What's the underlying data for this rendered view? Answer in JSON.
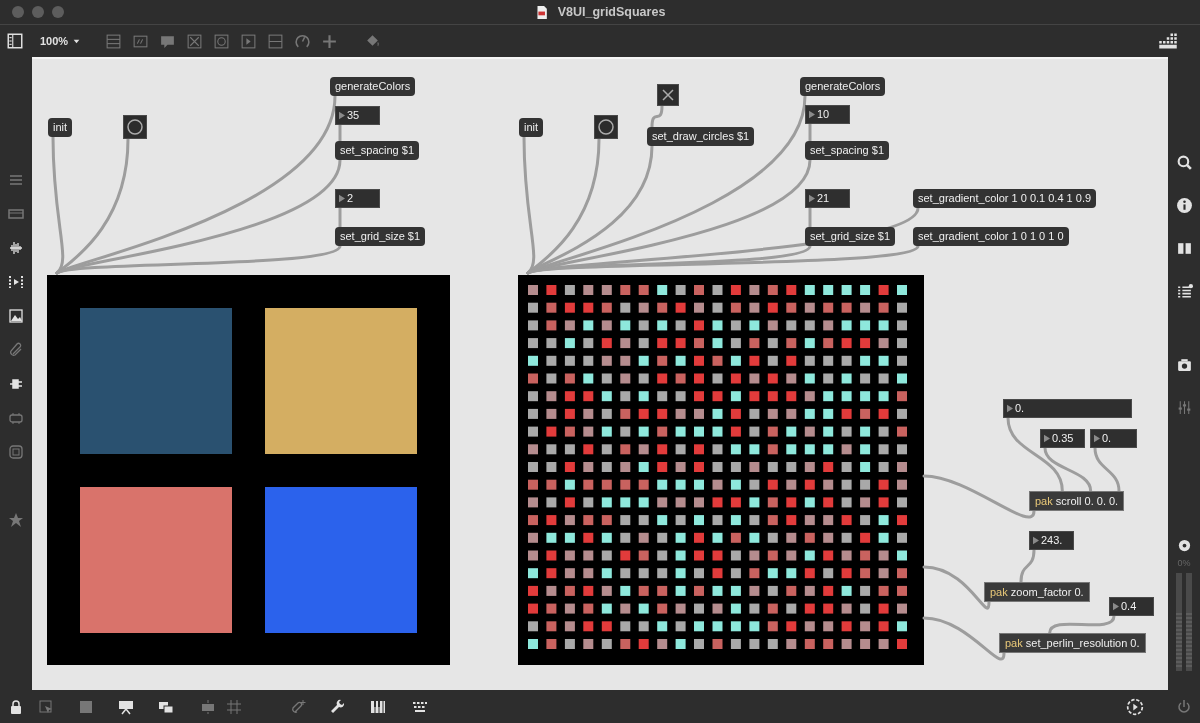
{
  "window": {
    "title": "V8UI_gridSquares"
  },
  "toolbar": {
    "zoom": "100%"
  },
  "left_display": {
    "squares": [
      {
        "color": "#2a5170"
      },
      {
        "color": "#d4ae62"
      },
      {
        "color": "#d9736b"
      },
      {
        "color": "#2b62ec"
      }
    ]
  },
  "objects": [
    {
      "kind": "message",
      "text": "generateColors"
    },
    {
      "kind": "number",
      "text": "35"
    },
    {
      "kind": "message",
      "text": "set_spacing $1"
    },
    {
      "kind": "number",
      "text": "2"
    },
    {
      "kind": "message",
      "text": "set_grid_size $1"
    },
    {
      "kind": "message",
      "text": "init"
    },
    {
      "kind": "bang"
    },
    {
      "kind": "toggle",
      "on": true
    },
    {
      "kind": "message",
      "text": "generateColors"
    },
    {
      "kind": "number",
      "text": "10"
    },
    {
      "kind": "message",
      "text": "set_spacing $1"
    },
    {
      "kind": "message",
      "text": "set_draw_circles $1"
    },
    {
      "kind": "message",
      "text": "init"
    },
    {
      "kind": "bang"
    },
    {
      "kind": "number",
      "text": "21"
    },
    {
      "kind": "message",
      "text": "set_gradient_color 1 0 0.1 0.4 1 0.9"
    },
    {
      "kind": "message",
      "text": "set_grid_size $1"
    },
    {
      "kind": "message",
      "text": "set_gradient_color 1 0 1 0 1 0"
    },
    {
      "kind": "number",
      "text": "0."
    },
    {
      "kind": "number",
      "text": "0.35"
    },
    {
      "kind": "number",
      "text": "0."
    },
    {
      "kind": "object",
      "class": "pak",
      "args": "scroll 0. 0. 0."
    },
    {
      "kind": "number",
      "text": "243."
    },
    {
      "kind": "object",
      "class": "pak",
      "args": "zoom_factor 0."
    },
    {
      "kind": "number",
      "text": "0.4"
    },
    {
      "kind": "object",
      "class": "pak",
      "args": "set_perlin_resolution 0."
    }
  ],
  "right_sidebar": {
    "meter_reading": "0%"
  }
}
